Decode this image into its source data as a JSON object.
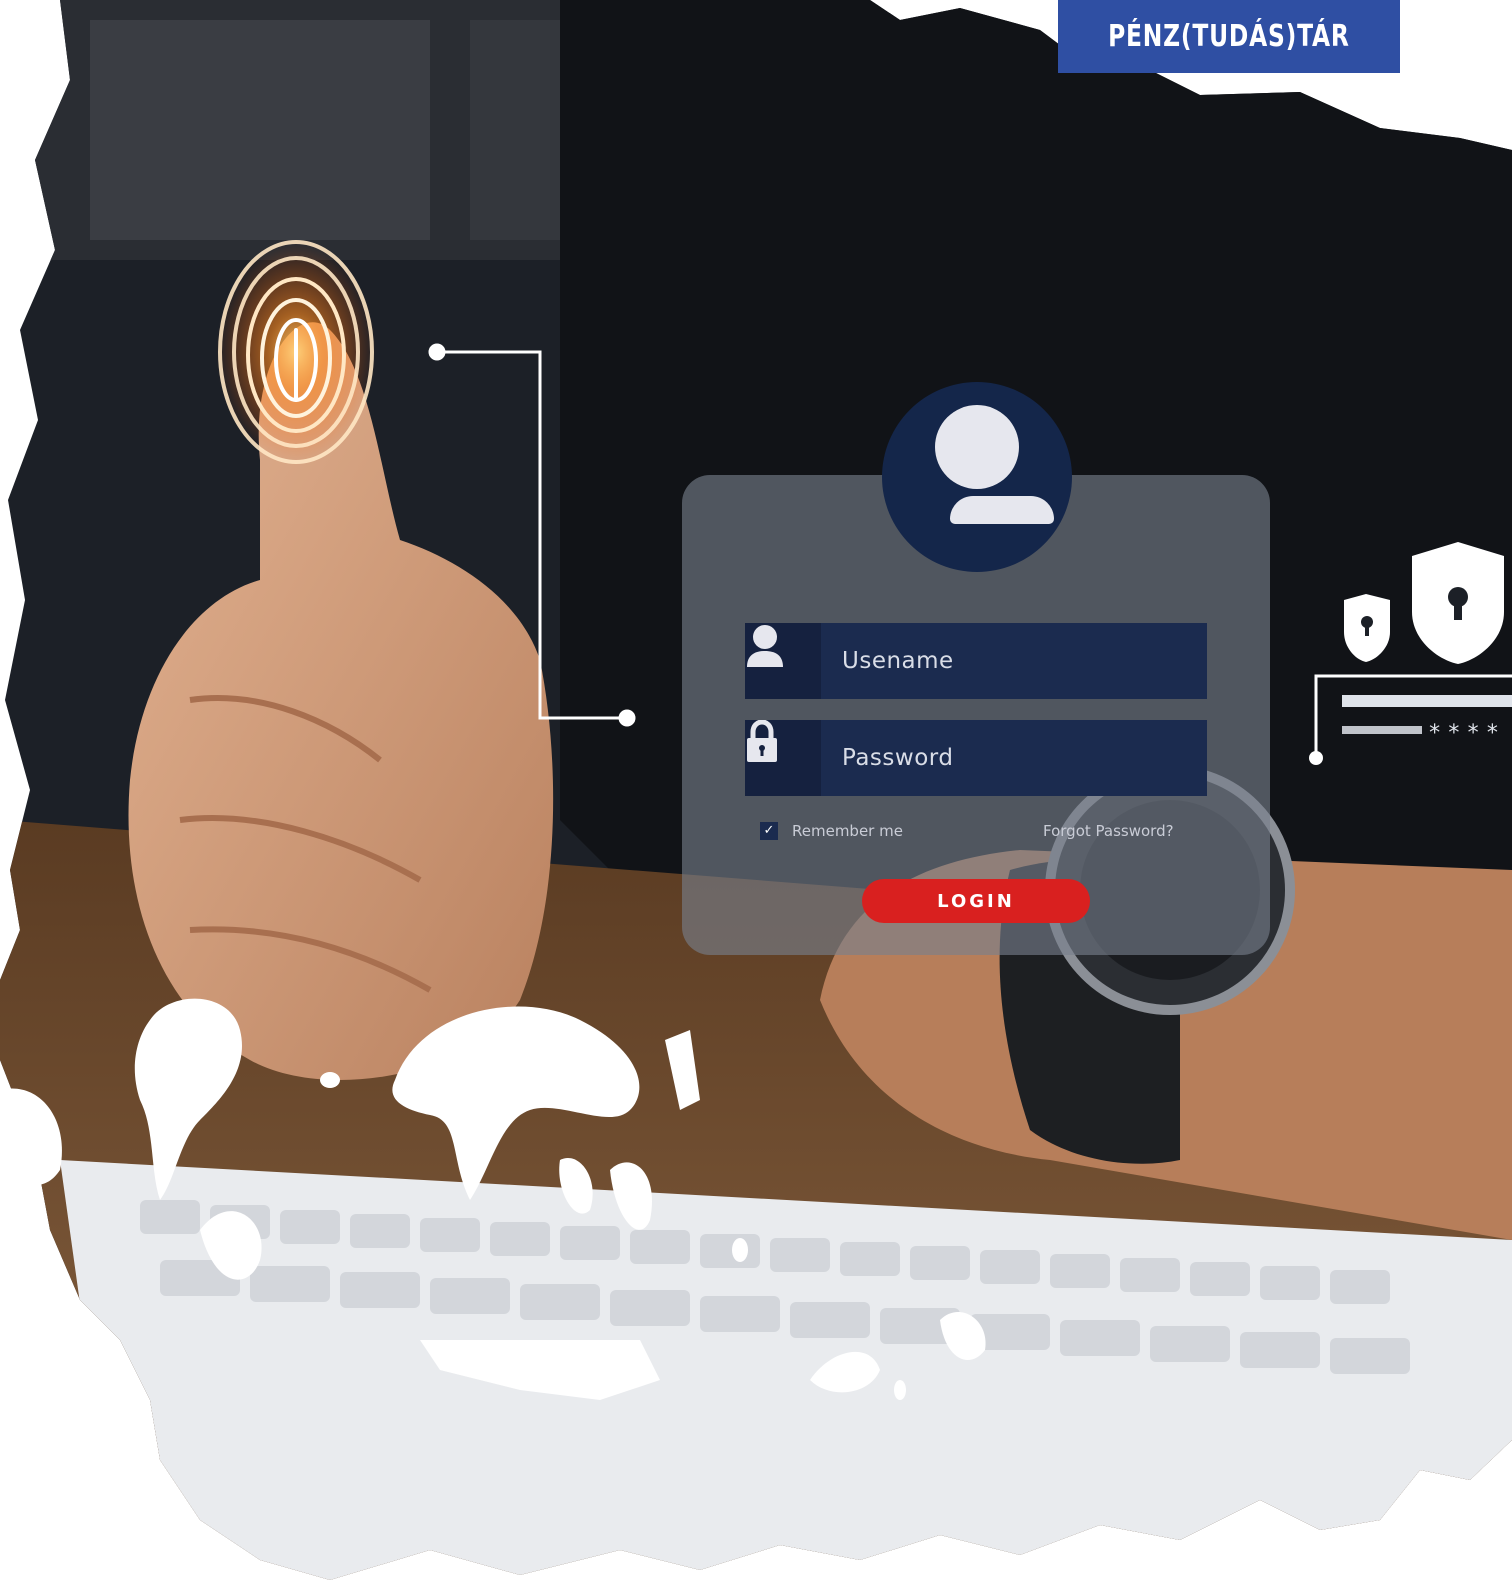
{
  "badge": {
    "text": "PÉNZ(TUDÁS)TÁR",
    "color": "#2f4fa3"
  },
  "login_form": {
    "username_placeholder": "Usename",
    "password_placeholder": "Password",
    "remember_label": "Remember me",
    "remember_checked": true,
    "forgot_label": "Forgot Password?",
    "login_label": "LOGIN",
    "login_color": "#d9201f"
  },
  "password_preview": {
    "masked": "****"
  },
  "icons": [
    "fingerprint-icon",
    "user-avatar-icon",
    "user-icon",
    "lock-icon",
    "shield-lock-icon",
    "check-icon"
  ]
}
